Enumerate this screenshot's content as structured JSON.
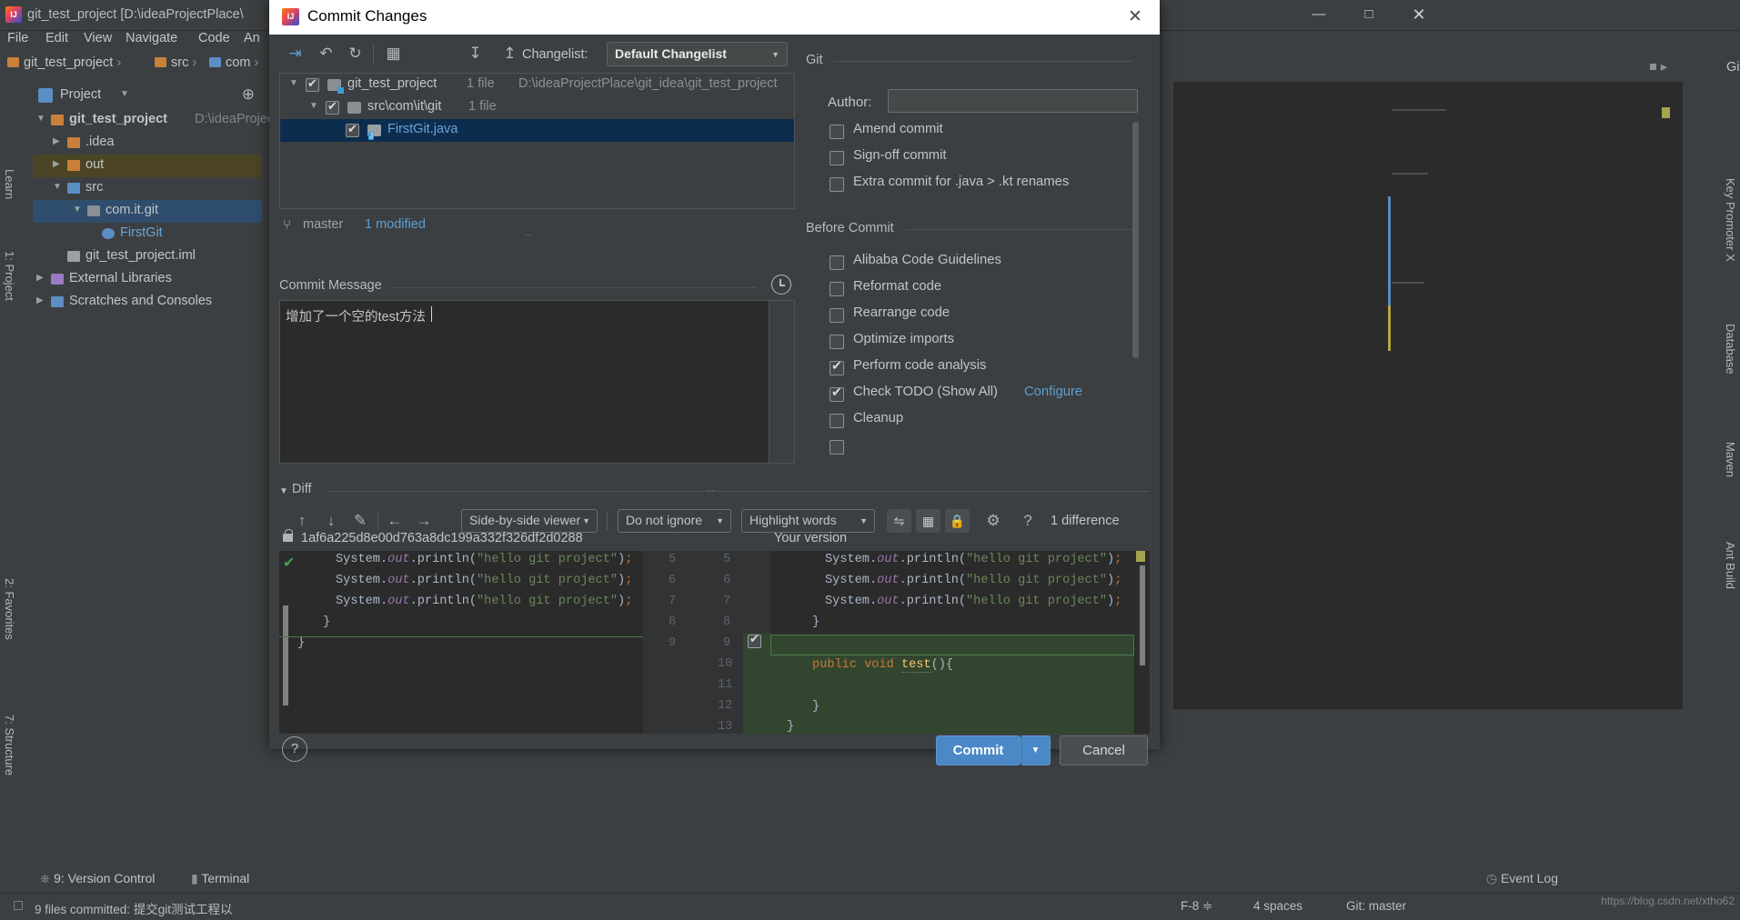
{
  "ide": {
    "title": "git_test_project [D:\\ideaProjectPlace\\",
    "menu": [
      "File",
      "Edit",
      "View",
      "Navigate",
      "Code",
      "An"
    ],
    "breadcrumb": [
      "git_test_project",
      "src",
      "com"
    ],
    "project_panel_label": "Project",
    "tree": [
      {
        "label": "git_test_project",
        "sub": "D:\\ideaProject",
        "depth": 0,
        "arrow": "▼",
        "kind": "project"
      },
      {
        "label": ".idea",
        "sub": "",
        "depth": 1,
        "arrow": "▶",
        "kind": "folder"
      },
      {
        "label": "out",
        "sub": "",
        "depth": 1,
        "arrow": "▶",
        "kind": "folder-out"
      },
      {
        "label": "src",
        "sub": "",
        "depth": 1,
        "arrow": "▼",
        "kind": "folder-src"
      },
      {
        "label": "com.it.git",
        "sub": "",
        "depth": 2,
        "arrow": "▼",
        "kind": "package"
      },
      {
        "label": "FirstGit",
        "sub": "",
        "depth": 3,
        "arrow": "",
        "kind": "class"
      },
      {
        "label": "git_test_project.iml",
        "sub": "",
        "depth": 1,
        "arrow": "",
        "kind": "iml"
      },
      {
        "label": "External Libraries",
        "sub": "",
        "depth": 0,
        "arrow": "▶",
        "kind": "lib"
      },
      {
        "label": "Scratches and Consoles",
        "sub": "",
        "depth": 0,
        "arrow": "▶",
        "kind": "scratch"
      }
    ],
    "left_tabs": [
      "Learn",
      "1: Project",
      "2: Favorites",
      "7: Structure"
    ],
    "right_tabs": [
      "Key Promoter X",
      "Database",
      "Maven",
      "Ant Build"
    ],
    "git_toolbar_label": "Git:",
    "statusbar": {
      "version_control": "9: Version Control",
      "terminal": "Terminal",
      "message": "9 files committed: 提交git测试工程以",
      "position": "F-8 ≑",
      "indent": "4 spaces",
      "branch": "Git: master",
      "event_log": "Event Log",
      "watermark": "https://blog.csdn.net/xtho62"
    }
  },
  "dialog": {
    "title": "Commit Changes",
    "close_icon": "✕",
    "toolbar": {
      "icons": [
        "collapse-arrow-icon",
        "undo-icon",
        "refresh-icon",
        "group-by-icon",
        "expand-all-icon",
        "collapse-all-icon"
      ],
      "changelist_label": "Changelist:",
      "changelist_value": "Default Changelist"
    },
    "file_tree": [
      {
        "label": "git_test_project",
        "count": "1 file",
        "path": "D:\\ideaProjectPlace\\git_idea\\git_test_project",
        "depth": 0,
        "arrow": "▼",
        "checked": true,
        "selected": false,
        "icon": "module-folder-icon"
      },
      {
        "label": "src\\com\\it\\git",
        "count": "1 file",
        "path": "",
        "depth": 1,
        "arrow": "▼",
        "checked": true,
        "selected": false,
        "icon": "folder-icon"
      },
      {
        "label": "FirstGit.java",
        "count": "",
        "path": "",
        "depth": 2,
        "arrow": "",
        "checked": true,
        "selected": true,
        "icon": "java-file-icon"
      }
    ],
    "branch": {
      "name": "master",
      "modified": "1 modified"
    },
    "commit_message": {
      "label": "Commit Message",
      "value": "增加了一个空的test方法",
      "history_icon": "clock-icon"
    },
    "git_section": {
      "title": "Git",
      "author_label": "Author:",
      "author_value": "",
      "options": [
        {
          "label": "Amend commit",
          "checked": false,
          "mnemonic": "m"
        },
        {
          "label": "Sign-off commit",
          "checked": false,
          "mnemonic": "g"
        },
        {
          "label": "Extra commit for .java > .kt renames",
          "checked": false,
          "mnemonic": ""
        }
      ]
    },
    "before_commit": {
      "title": "Before Commit",
      "options": [
        {
          "label": "Alibaba Code Guidelines",
          "checked": false,
          "mnemonic": ""
        },
        {
          "label": "Reformat code",
          "checked": false,
          "mnemonic": "R"
        },
        {
          "label": "Rearrange code",
          "checked": false,
          "mnemonic": "n"
        },
        {
          "label": "Optimize imports",
          "checked": false,
          "mnemonic": "O"
        },
        {
          "label": "Perform code analysis",
          "checked": true,
          "mnemonic": "y"
        },
        {
          "label": "Check TODO (Show All)",
          "checked": true,
          "link": "Configure",
          "mnemonic": ""
        },
        {
          "label": "Cleanup",
          "checked": false,
          "mnemonic": "l"
        }
      ]
    },
    "diff": {
      "section_title": "Diff",
      "toolbar": {
        "prev_icon": "arrow-up-icon",
        "next_icon": "arrow-down-icon",
        "edit_icon": "pencil-icon",
        "left_icon": "arrow-left-icon",
        "right_icon": "arrow-right-icon",
        "viewer_mode": "Side-by-side viewer",
        "whitespace": "Do not ignore",
        "highlight": "Highlight words",
        "collapse_icon": "collapse-unchanged-icon",
        "columns_icon": "columns-icon",
        "lock_icon": "lock-icon",
        "settings_icon": "gear-icon",
        "help_icon": "?",
        "difference_count": "1 difference"
      },
      "left_header": "1af6a225d8e00d763a8dc199a332f326df2d0288",
      "right_header": "Your version",
      "left_lines": [
        "        System.out.println(\"hello git project\");",
        "        System.out.println(\"hello git project\");",
        "        System.out.println(\"hello git project\");",
        "    }",
        "}"
      ],
      "left_numbers": [
        "5",
        "6",
        "7",
        "8",
        "9"
      ],
      "right_numbers": [
        "5",
        "6",
        "7",
        "8",
        "9",
        "10",
        "11",
        "12",
        "13"
      ],
      "right_lines": [
        "        System.out.println(\"hello git project\");",
        "        System.out.println(\"hello git project\");",
        "        System.out.println(\"hello git project\");",
        "    }",
        "",
        "    public void test(){",
        "",
        "    }",
        "}"
      ]
    },
    "footer": {
      "help_label": "?",
      "commit_label": "Commit",
      "commit_arrow": "▼",
      "cancel_label": "Cancel"
    }
  }
}
